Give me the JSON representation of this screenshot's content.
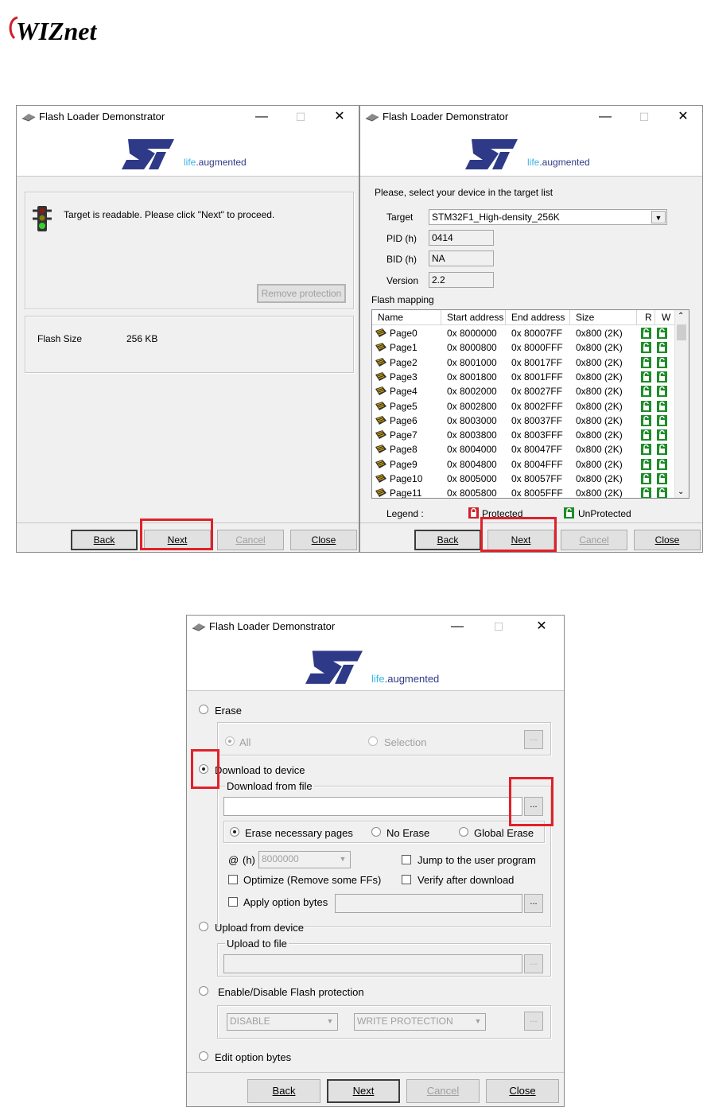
{
  "brand": {
    "company": "WIZnet"
  },
  "windows": {
    "w1": {
      "title": "Flash Loader Demonstrator",
      "brand_life": "life",
      "brand_aug": ".augmented",
      "status_text": "Target is readable. Please click \"Next\" to proceed.",
      "remove_protection": "Remove protection",
      "flash_size_label": "Flash Size",
      "flash_size_value": "256 KB",
      "buttons": {
        "back": "Back",
        "next": "Next",
        "cancel": "Cancel",
        "close": "Close"
      }
    },
    "w2": {
      "title": "Flash Loader Demonstrator",
      "brand_life": "life",
      "brand_aug": ".augmented",
      "instruction": "Please, select your device in the target list",
      "target_label": "Target",
      "target_value": "STM32F1_High-density_256K",
      "pid_label": "PID  (h)",
      "pid_value": "0414",
      "bid_label": "BID  (h)",
      "bid_value": "NA",
      "version_label": "Version",
      "version_value": "2.2",
      "mapping_label": "Flash mapping",
      "columns": [
        "Name",
        "Start address",
        "End address",
        "Size",
        "R",
        "W"
      ],
      "pages": [
        {
          "name": "Page0",
          "start": "0x 8000000",
          "end": "0x 80007FF",
          "size": "0x800 (2K)"
        },
        {
          "name": "Page1",
          "start": "0x 8000800",
          "end": "0x 8000FFF",
          "size": "0x800 (2K)"
        },
        {
          "name": "Page2",
          "start": "0x 8001000",
          "end": "0x 80017FF",
          "size": "0x800 (2K)"
        },
        {
          "name": "Page3",
          "start": "0x 8001800",
          "end": "0x 8001FFF",
          "size": "0x800 (2K)"
        },
        {
          "name": "Page4",
          "start": "0x 8002000",
          "end": "0x 80027FF",
          "size": "0x800 (2K)"
        },
        {
          "name": "Page5",
          "start": "0x 8002800",
          "end": "0x 8002FFF",
          "size": "0x800 (2K)"
        },
        {
          "name": "Page6",
          "start": "0x 8003000",
          "end": "0x 80037FF",
          "size": "0x800 (2K)"
        },
        {
          "name": "Page7",
          "start": "0x 8003800",
          "end": "0x 8003FFF",
          "size": "0x800 (2K)"
        },
        {
          "name": "Page8",
          "start": "0x 8004000",
          "end": "0x 80047FF",
          "size": "0x800 (2K)"
        },
        {
          "name": "Page9",
          "start": "0x 8004800",
          "end": "0x 8004FFF",
          "size": "0x800 (2K)"
        },
        {
          "name": "Page10",
          "start": "0x 8005000",
          "end": "0x 80057FF",
          "size": "0x800 (2K)"
        },
        {
          "name": "Page11",
          "start": "0x 8005800",
          "end": "0x 8005FFF",
          "size": "0x800 (2K)"
        }
      ],
      "legend_label": "Legend :",
      "legend_protected": "Protected",
      "legend_unprotected": "UnProtected",
      "buttons": {
        "back": "Back",
        "next": "Next",
        "cancel": "Cancel",
        "close": "Close"
      }
    },
    "w3": {
      "title": "Flash Loader Demonstrator",
      "brand_life": "life",
      "brand_aug": ".augmented",
      "erase": "Erase",
      "all": "All",
      "selection": "Selection",
      "download_to_device": "Download to device",
      "download_from_file": "Download from file",
      "erase_necessary": "Erase necessary pages",
      "no_erase": "No Erase",
      "global_erase": "Global Erase",
      "at_label": "@",
      "h_label": "(h)",
      "address_value": "8000000",
      "jump_user": "Jump to the user program",
      "optimize": "Optimize (Remove some FFs)",
      "verify": "Verify after download",
      "apply_option": "Apply option bytes",
      "upload_from_device": "Upload from device",
      "upload_to_file": "Upload to file",
      "enable_disable": "Enable/Disable Flash protection",
      "disable_value": "DISABLE",
      "write_protection_value": "WRITE PROTECTION",
      "edit_option": "Edit option bytes",
      "ellipsis": "...",
      "buttons": {
        "back": "Back",
        "next": "Next",
        "cancel": "Cancel",
        "close": "Close"
      }
    }
  },
  "colors": {
    "highlight": "#e0212a",
    "st_blue": "#2e3a87",
    "st_light": "#3cb4e5",
    "lock_green": "#1e8c2a",
    "lock_red": "#d0202a"
  }
}
